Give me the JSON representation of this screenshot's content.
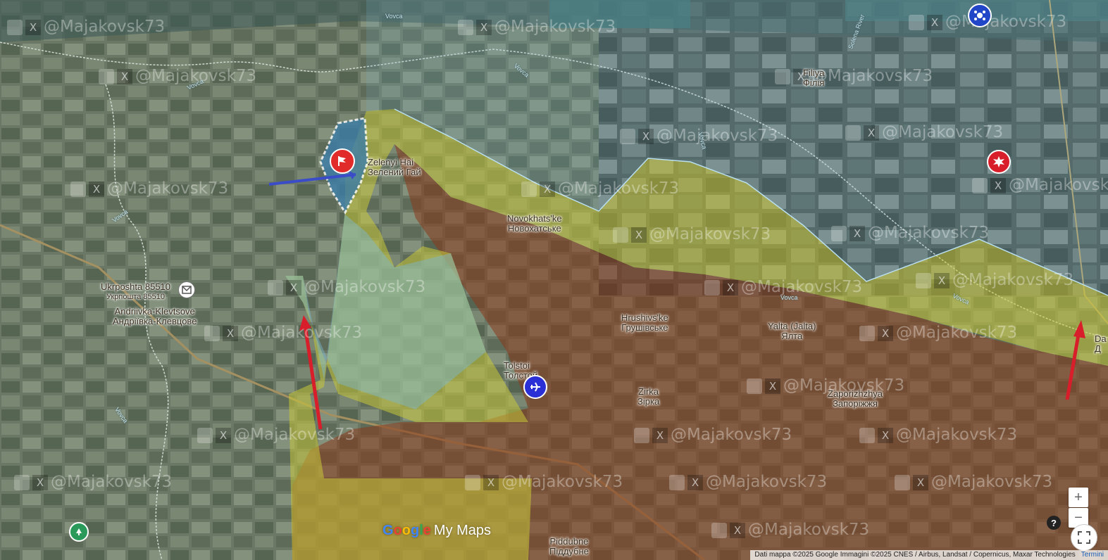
{
  "places": [
    {
      "key": "zelenyi",
      "en": "Zelenyi Hai",
      "local": "Зелений Гай"
    },
    {
      "key": "novokhatske",
      "en": "Novokhats'ke",
      "local": "Новохатське"
    },
    {
      "key": "hrushivske",
      "en": "Hrushivs'ke",
      "local": "Грушівське"
    },
    {
      "key": "yalta",
      "en": "Yalta (Jalta)",
      "local": "Ялта"
    },
    {
      "key": "tolstoi",
      "en": "Tolstoi",
      "local": "Толстой"
    },
    {
      "key": "zirka",
      "en": "Zirka",
      "local": "Зірка"
    },
    {
      "key": "zaporizhzhya",
      "en": "Zaporizhzhya",
      "local": "Запоріжжя"
    },
    {
      "key": "piddubne",
      "en": "Piddubne",
      "local": "Піддубне"
    },
    {
      "key": "filiya",
      "en": "Filiya",
      "local": "Філія"
    },
    {
      "key": "andriivka",
      "en": "Andriivka-Klevtsove",
      "local": "Андріївка-Клевцове"
    },
    {
      "key": "ukrposhta",
      "en": "Ukrposhta 85510",
      "local": "Укрпошта 85510"
    },
    {
      "key": "edge",
      "en": "Da",
      "local": "Д"
    }
  ],
  "rivers": [
    "Vovca",
    "Vovca",
    "Vovca",
    "Vovca",
    "Vovca",
    "Vovca",
    "Vovca",
    "Vovca",
    "Solena River"
  ],
  "watermark": "@Majakovsk73",
  "watermark_x": "X",
  "logo": {
    "g1": "G",
    "g2": "o",
    "g3": "o",
    "g4": "g",
    "g5": "l",
    "g6": "e",
    "rest": "My Maps"
  },
  "controls": {
    "zoom_in": "+",
    "zoom_out": "−",
    "help": "?"
  },
  "footer": {
    "attribution": "Dati mappa ©2025 Google Immagini ©2025 CNES / Airbus, Landsat / Copernicus, Maxar Technologies",
    "terms": "Termini"
  },
  "colors": {
    "russian_controlled": "#8a3a1c",
    "contested": "#c8c83a",
    "ukrainian_controlled": "#7ab8d4",
    "attack_arrow": "#d81e2a"
  },
  "icons": [
    "flag-marker-icon",
    "drone-marker-icon",
    "explosion-marker-icon",
    "aircraft-marker-icon",
    "post-office-icon",
    "park-marker-icon"
  ]
}
